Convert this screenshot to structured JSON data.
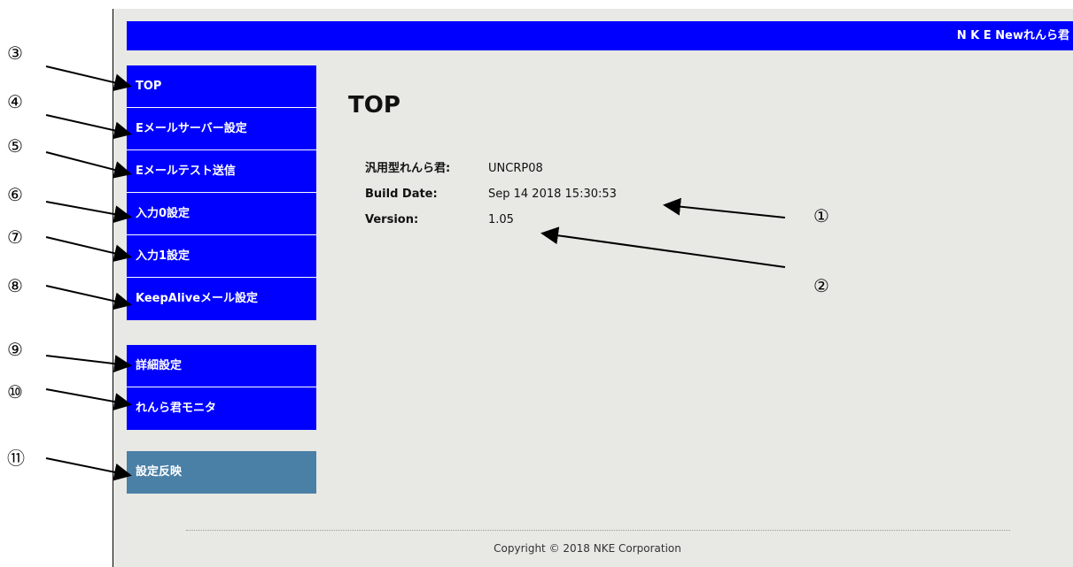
{
  "header": {
    "title": "N K E  Newれんら君"
  },
  "nav": {
    "group1": [
      {
        "label": "TOP"
      },
      {
        "label": "Eメールサーバー設定"
      },
      {
        "label": "Eメールテスト送信"
      },
      {
        "label": "入力0設定"
      },
      {
        "label": "入力1設定"
      },
      {
        "label": "KeepAliveメール設定"
      }
    ],
    "group2": [
      {
        "label": "詳細設定"
      },
      {
        "label": "れんら君モニタ"
      }
    ],
    "apply": {
      "label": "設定反映"
    }
  },
  "main": {
    "title": "TOP",
    "info": [
      {
        "label": "汎用型れんら君:",
        "value": "UNCRP08"
      },
      {
        "label": "Build Date:",
        "value": "Sep 14 2018 15:30:53"
      },
      {
        "label": "Version:",
        "value": "1.05"
      }
    ]
  },
  "footer": {
    "copyright": "Copyright © 2018 NKE Corporation"
  },
  "annotations": {
    "m1": "①",
    "m2": "②",
    "m3": "③",
    "m4": "④",
    "m5": "⑤",
    "m6": "⑥",
    "m7": "⑦",
    "m8": "⑧",
    "m9": "⑨",
    "m10": "⑩",
    "m11": "⑪"
  },
  "colors": {
    "nav_blue": "#0000ff",
    "apply_blue": "#4a7fa6",
    "background": "#e8e8e4"
  }
}
